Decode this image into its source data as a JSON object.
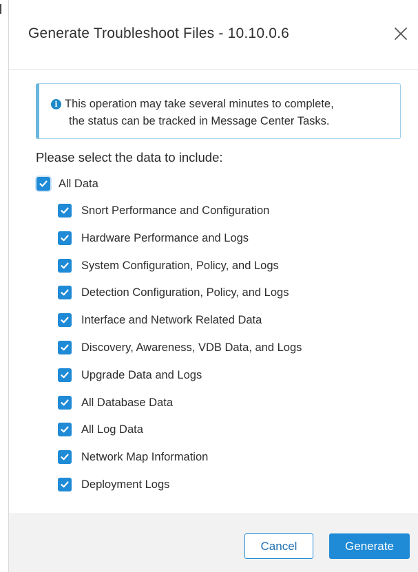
{
  "dialog": {
    "title": "Generate Troubleshoot Files - 10.10.0.6",
    "close_icon": "close-icon"
  },
  "info": {
    "icon": "info-icon",
    "line1": "This operation may take several minutes to complete,",
    "line2": "the status can be tracked in Message Center Tasks."
  },
  "prompt": "Please select the data to include:",
  "all_data": {
    "label": "All Data",
    "checked": true
  },
  "options": [
    {
      "label": "Snort Performance and Configuration",
      "checked": true
    },
    {
      "label": "Hardware Performance and Logs",
      "checked": true
    },
    {
      "label": "System Configuration, Policy, and Logs",
      "checked": true
    },
    {
      "label": "Detection Configuration, Policy, and Logs",
      "checked": true
    },
    {
      "label": "Interface and Network Related Data",
      "checked": true
    },
    {
      "label": "Discovery, Awareness, VDB Data, and Logs",
      "checked": true
    },
    {
      "label": "Upgrade Data and Logs",
      "checked": true
    },
    {
      "label": "All Database Data",
      "checked": true
    },
    {
      "label": "All Log Data",
      "checked": true
    },
    {
      "label": "Network Map Information",
      "checked": true
    },
    {
      "label": "Deployment Logs",
      "checked": true
    }
  ],
  "footer": {
    "cancel_label": "Cancel",
    "generate_label": "Generate"
  },
  "colors": {
    "accent": "#1f8ad6",
    "info_border": "#6bb7de"
  }
}
